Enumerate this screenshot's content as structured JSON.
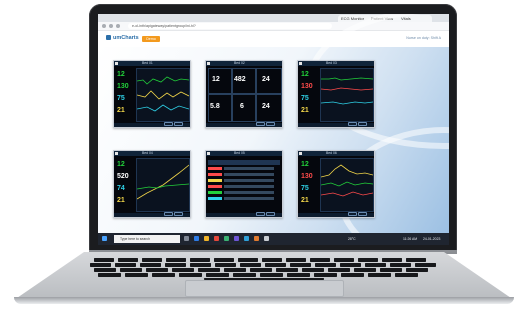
{
  "browser": {
    "tabs": [
      {
        "label": "ECG Monitor"
      },
      {
        "label": "Patient View"
      },
      {
        "label": "Vitals"
      }
    ],
    "url": "e-ol-inth/apigateway/patientgroup/ini-hl?",
    "controls": {
      "back": "back-icon",
      "forward": "forward-icon",
      "reload": "reload-icon"
    }
  },
  "app": {
    "logo": "umCharts",
    "primary_button": "Demo",
    "header_right": "Nurse on duty: Shift A"
  },
  "monitors": [
    {
      "title": "Bed 01",
      "values": [
        "12",
        "130",
        "75",
        "21"
      ]
    },
    {
      "title": "Bed 02",
      "values": [
        "12",
        "482",
        "24",
        "5.8",
        "6",
        "24"
      ]
    },
    {
      "title": "Bed 03",
      "values": [
        "12",
        "130",
        "75",
        "21"
      ]
    },
    {
      "title": "Bed 04",
      "values": [
        "12",
        "520",
        "74",
        "21"
      ]
    },
    {
      "title": "Bed 05",
      "values": [
        "",
        "",
        "",
        ""
      ]
    },
    {
      "title": "Bed 06",
      "values": [
        "12",
        "130",
        "75",
        "21"
      ]
    }
  ],
  "taskbar": {
    "search_placeholder": "Type here to search",
    "weather": "28°C",
    "time": "11:26 AM",
    "date": "24-01-2023"
  },
  "colors": {
    "brand": "#2c6fa9",
    "accent": "#f39a1e",
    "wave_green": "#22d13a",
    "wave_yellow": "#f2d64a",
    "wave_red": "#ff4b4b",
    "wave_cyan": "#2fd2e8"
  }
}
